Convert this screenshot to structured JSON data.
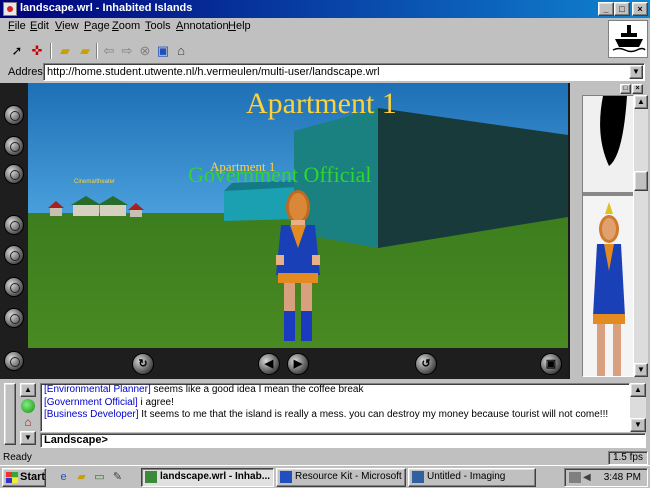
{
  "window": {
    "title": "landscape.wrl - Inhabited Islands",
    "controls": [
      "_",
      "□",
      "×"
    ]
  },
  "menu": [
    "File",
    "Edit",
    "View",
    "Page",
    "Zoom",
    "Tools",
    "Annotation",
    "Help"
  ],
  "toolbar": {
    "icons": [
      "pointer-icon",
      "stop-sign-icon",
      "open-folder-icon",
      "save-folder-icon",
      "back-arrow-icon",
      "forward-arrow-icon",
      "stop-icon",
      "refresh-icon",
      "home-icon"
    ]
  },
  "address": {
    "label": "Address",
    "url": "http://home.student.utwente.nl/h.vermeulen/multi-user/landscape.wrl"
  },
  "scene": {
    "building_label_large": "Apartment 1",
    "building_label_small": "Apartment 1",
    "avatar_label": "Government Official",
    "distant_label": "Cinema/theater",
    "colors": {
      "sky": "#2a84c6",
      "grass": "#3f7a1f",
      "building": "#1f4a4a",
      "text_gold": "#ffd23a",
      "text_green": "#2ed62e"
    }
  },
  "viewer_nav": {
    "left_buttons": [
      "walk",
      "fly",
      "study",
      "plane",
      "turn",
      "roll",
      "goto"
    ],
    "bottom_buttons": [
      "restore",
      "prev-view",
      "next-view",
      "undo",
      "fit"
    ]
  },
  "chat": {
    "messages": [
      {
        "who": "[Environmental Planner]",
        "text": "seems like a good idea I mean the coffee break"
      },
      {
        "who": "[Government Official]",
        "text": "i agree!"
      },
      {
        "who": "[Business Developer]",
        "text": "It seems to me that the island is really a mess. you can destroy my money because tourist will not come!!!"
      }
    ],
    "input_prompt": "Landscape>"
  },
  "status": {
    "text": "Ready",
    "fps": "1.5 fps"
  },
  "taskbar": {
    "start": "Start",
    "tasks": [
      {
        "label": "landscape.wrl - Inhab...",
        "active": true
      },
      {
        "label": "Resource Kit - Microsoft In...",
        "active": false
      },
      {
        "label": "Untitled - Imaging",
        "active": false
      }
    ],
    "clock": "3:48 PM"
  }
}
